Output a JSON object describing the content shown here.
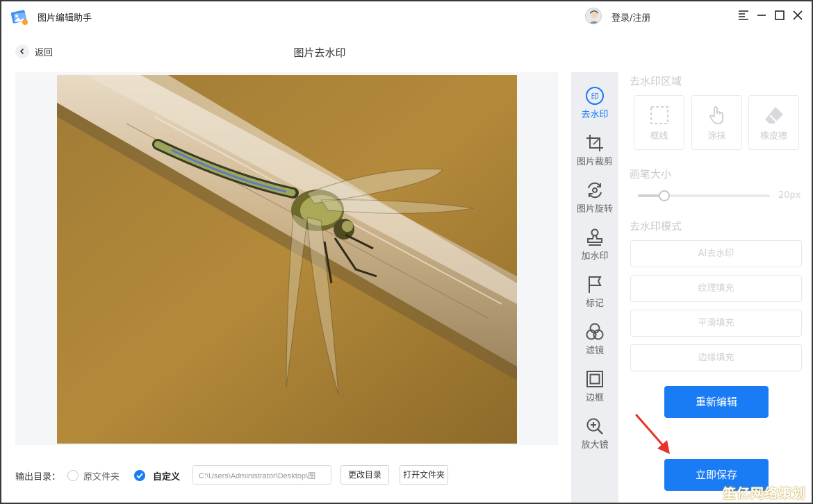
{
  "app": {
    "title": "图片编辑助手",
    "login": "登录/注册"
  },
  "subheader": {
    "back": "返回",
    "title": "图片去水印"
  },
  "tools": [
    {
      "label": "去水印",
      "icon": "watermark-seal-icon",
      "active": true
    },
    {
      "label": "图片裁剪",
      "icon": "crop-icon",
      "active": false
    },
    {
      "label": "图片旋转",
      "icon": "rotate-icon",
      "active": false
    },
    {
      "label": "加水印",
      "icon": "stamp-icon",
      "active": false
    },
    {
      "label": "标记",
      "icon": "flag-icon",
      "active": false
    },
    {
      "label": "滤镜",
      "icon": "filter-icon",
      "active": false
    },
    {
      "label": "边框",
      "icon": "border-icon",
      "active": false
    },
    {
      "label": "放大镜",
      "icon": "zoom-icon",
      "active": false
    }
  ],
  "panel": {
    "area_title": "去水印区域",
    "area_buttons": [
      "框线",
      "涂抹",
      "橡皮擦"
    ],
    "brush_title": "画笔大小",
    "brush_value": "20px",
    "brush_level": 0.2,
    "mode_title": "去水印模式",
    "modes": [
      "AI去水印",
      "纹理填充",
      "平滑填充",
      "边缘填充"
    ],
    "reedit": "重新编辑",
    "save": "立即保存"
  },
  "output": {
    "label": "输出目录：",
    "option_original": "原文件夹",
    "option_custom": "自定义",
    "path": "C:\\Users\\Administrator\\Desktop\\图",
    "change_dir": "更改目录",
    "open_folder": "打开文件夹"
  },
  "watermark_text": "笙亿网络策划",
  "colors": {
    "accent": "#1a7cf5",
    "annotation_arrow": "#e8332a"
  }
}
